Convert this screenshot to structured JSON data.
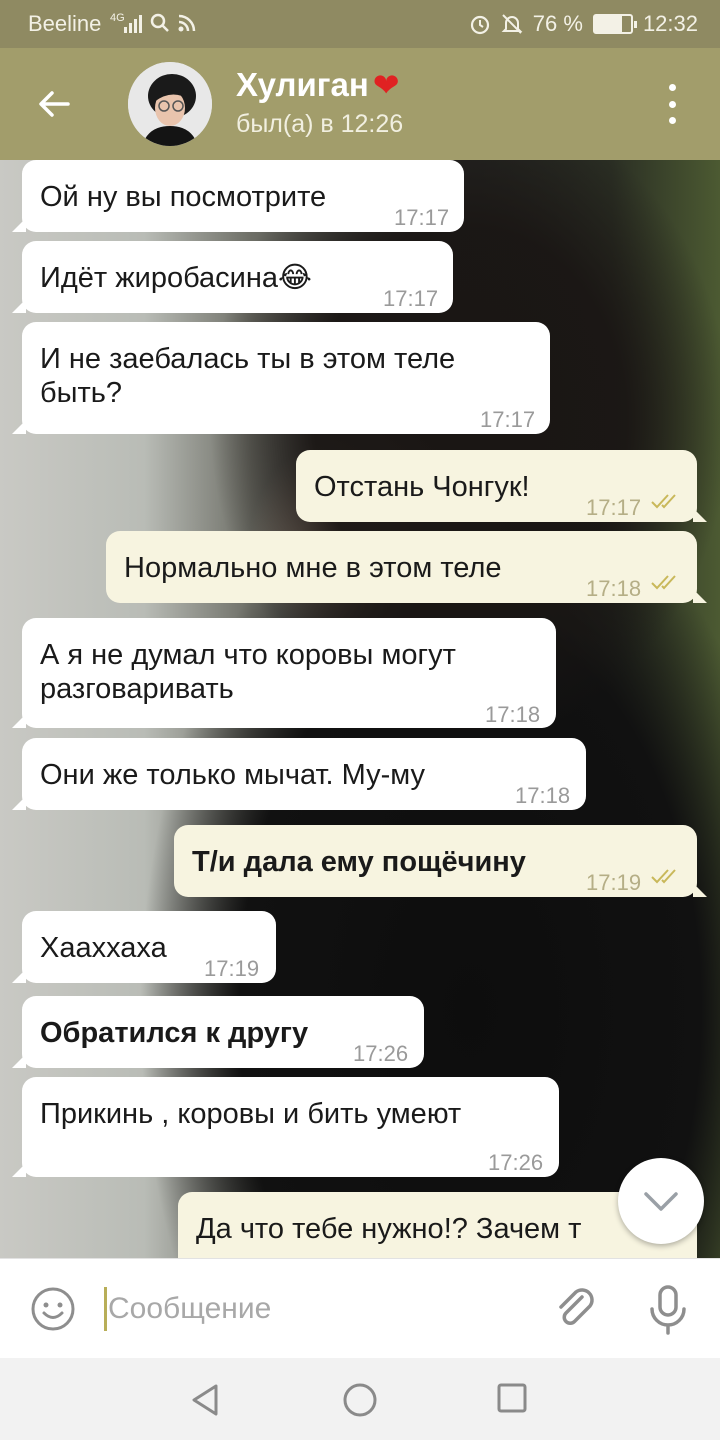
{
  "status_bar": {
    "carrier": "Beeline",
    "network": "4G",
    "battery": "76 %",
    "battery_level": 0.76,
    "time": "12:32"
  },
  "header": {
    "contact_name": "Хулиган",
    "name_emoji": "❤",
    "last_seen": "был(а) в 12:26"
  },
  "messages": [
    {
      "direction": "in",
      "text": "Ой ну вы посмотрите",
      "time": "17:17"
    },
    {
      "direction": "in",
      "text": "Идёт жиробасина😂",
      "time": "17:17"
    },
    {
      "direction": "in",
      "text": "И не заебалась ты в этом теле\nбыть?",
      "time": "17:17"
    },
    {
      "direction": "out",
      "text": "Отстань Чонгук!",
      "time": "17:17",
      "read": true
    },
    {
      "direction": "out",
      "text": "Нормально мне в этом теле",
      "time": "17:18",
      "read": true
    },
    {
      "direction": "in",
      "text": "А я не думал что коровы могут\nразговаривать",
      "time": "17:18"
    },
    {
      "direction": "in",
      "text": "Они же только мычат. Му-му",
      "time": "17:18"
    },
    {
      "direction": "out",
      "text": "Т/и дала ему пощёчину",
      "time": "17:19",
      "read": true,
      "bold": true
    },
    {
      "direction": "in",
      "text": "Хааххаха",
      "time": "17:19"
    },
    {
      "direction": "in",
      "text": "Обратился к другу",
      "time": "17:26",
      "bold": true
    },
    {
      "direction": "in",
      "text": "Прикинь , коровы и бить умеют",
      "time": "17:26"
    },
    {
      "direction": "out",
      "text": "Да что тебе нужно!? Зачем т",
      "time": ""
    }
  ],
  "input": {
    "placeholder": "Сообщение",
    "value": ""
  },
  "icons": {
    "back": "back-arrow-icon",
    "menu": "more-vert-icon",
    "emoji": "emoji-icon",
    "attach": "paperclip-icon",
    "mic": "microphone-icon",
    "scroll": "chevron-down-icon"
  },
  "colors": {
    "header": "#a29d6b",
    "status_bar": "#8f8a62",
    "incoming_bubble": "#ffffff",
    "outgoing_bubble": "#f7f4e0",
    "read_check": "#c9b85a"
  }
}
